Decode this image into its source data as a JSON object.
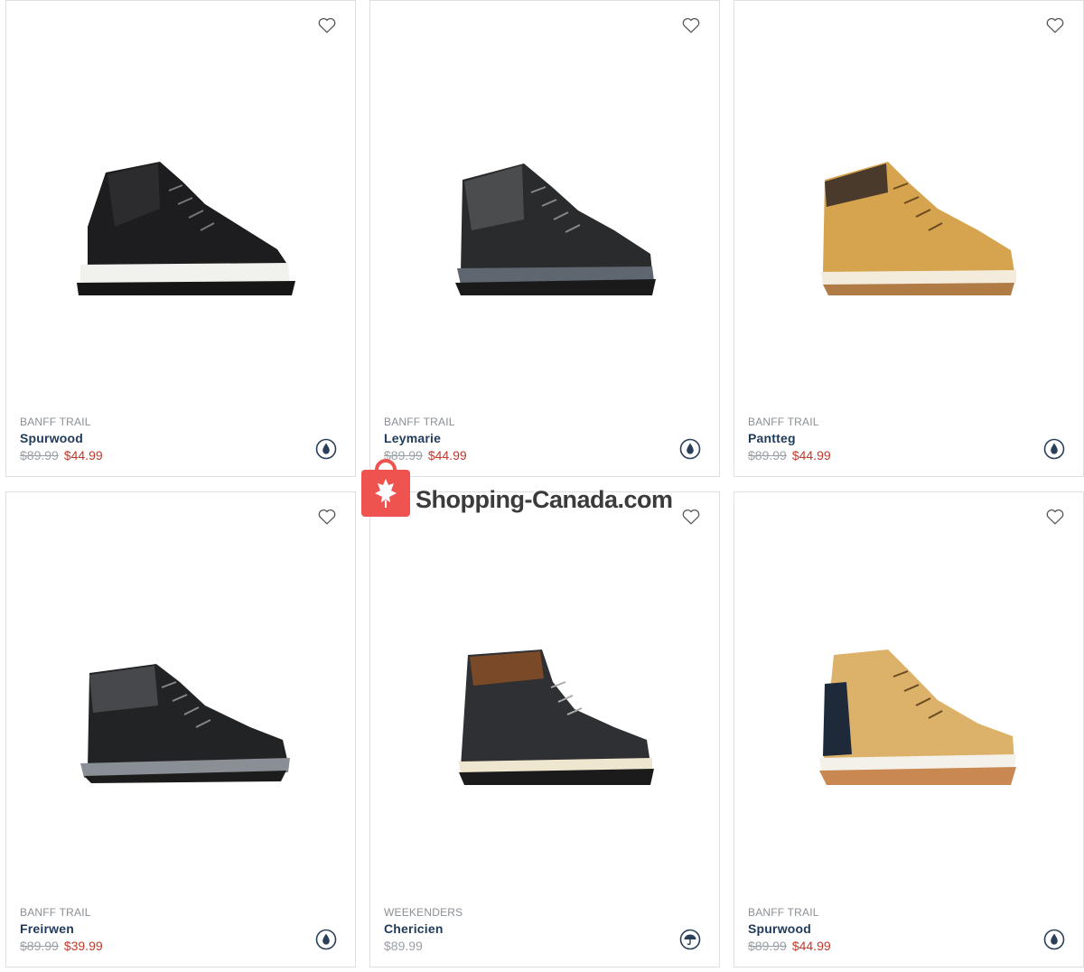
{
  "products": [
    {
      "brand": "BANFF TRAIL",
      "name": "Spurwood",
      "old_price": "$89.99",
      "price": "$44.99",
      "feature_icon": "water-resistant-icon",
      "wishlist_icon": "heart-icon"
    },
    {
      "brand": "BANFF TRAIL",
      "name": "Leymarie",
      "old_price": "$89.99",
      "price": "$44.99",
      "feature_icon": "water-resistant-icon",
      "wishlist_icon": "heart-icon"
    },
    {
      "brand": "BANFF TRAIL",
      "name": "Pantteg",
      "old_price": "$89.99",
      "price": "$44.99",
      "feature_icon": "water-resistant-icon",
      "wishlist_icon": "heart-icon"
    },
    {
      "brand": "BANFF TRAIL",
      "name": "Freirwen",
      "old_price": "$89.99",
      "price": "$39.99",
      "feature_icon": "water-resistant-icon",
      "wishlist_icon": "heart-icon"
    },
    {
      "brand": "WEEKENDERS",
      "name": "Chericien",
      "price": "$89.99",
      "feature_icon": "umbrella-icon",
      "wishlist_icon": "heart-icon"
    },
    {
      "brand": "BANFF TRAIL",
      "name": "Spurwood",
      "old_price": "$89.99",
      "price": "$44.99",
      "feature_icon": "water-resistant-icon",
      "wishlist_icon": "heart-icon"
    }
  ],
  "watermark": {
    "text": "Shopping-Canada.com",
    "icon": "maple-leaf-bag-icon"
  },
  "colors": {
    "sale": "#c0392b",
    "name": "#1f3a5a",
    "watermark_red": "#ef5350"
  }
}
